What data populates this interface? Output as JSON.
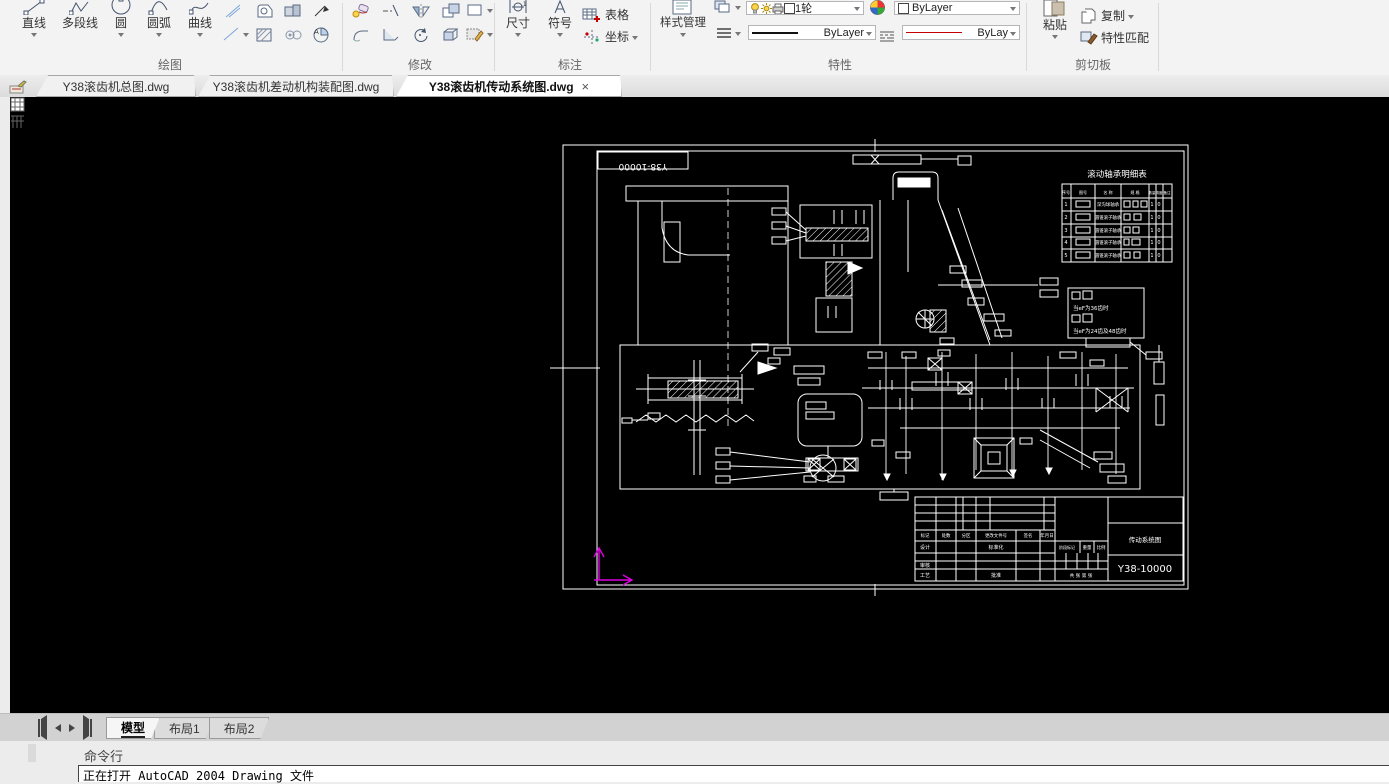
{
  "ribbon": {
    "draw": {
      "label": "绘图",
      "line": "直线",
      "polyline": "多段线",
      "circle": "圆",
      "arc": "圆弧",
      "spline": "曲线"
    },
    "modify": {
      "label": "修改"
    },
    "annotate": {
      "label": "标注",
      "dimension": "尺寸",
      "symbol": "符号",
      "table": "表格",
      "coordinate": "坐标"
    },
    "properties": {
      "label": "特性",
      "style_manager": "样式管理",
      "layer_value": "1轮",
      "color_value": "ByLayer",
      "lineweight_value": "ByLayer",
      "linetype_value": "ByLay"
    },
    "clipboard": {
      "label": "剪切板",
      "paste": "粘贴",
      "copy": "复制",
      "match_properties": "特性匹配"
    }
  },
  "document_tabs": {
    "tab1": "Y38滚齿机总图.dwg",
    "tab2": "Y38滚齿机差动机构装配图.dwg",
    "tab3": "Y38滚齿机传动系统图.dwg",
    "close_glyph": "×"
  },
  "drawing": {
    "corner_label": "Y38-10000",
    "bearing_table": {
      "title": "滚动轴承明细表",
      "headers": [
        "序号",
        "图号",
        "名 称",
        "规 格",
        "数量",
        "精度",
        "备注"
      ],
      "rows": [
        {
          "seq": "1",
          "name": "深沟球轴承",
          "qty": "1",
          "acc": "0"
        },
        {
          "seq": "2",
          "name": "圆锥滚子轴承",
          "qty": "1",
          "acc": "0"
        },
        {
          "seq": "3",
          "name": "圆锥滚子轴承",
          "qty": "1",
          "acc": "0"
        },
        {
          "seq": "4",
          "name": "圆锥滚子轴承",
          "qty": "1",
          "acc": "0"
        },
        {
          "seq": "5",
          "name": "圆锥滚子轴承",
          "qty": "1",
          "acc": "0"
        }
      ]
    },
    "notes": {
      "line1": "当eF为36齿时",
      "line2": "当eF为24齿及48齿时"
    },
    "title_block": {
      "c1": "标记",
      "c2": "处数",
      "c3": "分区",
      "c4": "更改文件号",
      "c5": "签名",
      "c6": "年月日",
      "design": "设计",
      "standardize": "标准化",
      "check": "审核",
      "process": "工艺",
      "approve": "批准",
      "stage": "阶段标记",
      "weight": "重量",
      "scale": "比例",
      "sheets": "共 张 第 张",
      "title": "传动系统图",
      "number": "Y38-10000"
    }
  },
  "layout_bar": {
    "model": "模型",
    "layout1": "布局1",
    "layout2": "布局2"
  },
  "command": {
    "title": "命令行",
    "history": "正在打开 AutoCAD 2004 Drawing 文件"
  }
}
